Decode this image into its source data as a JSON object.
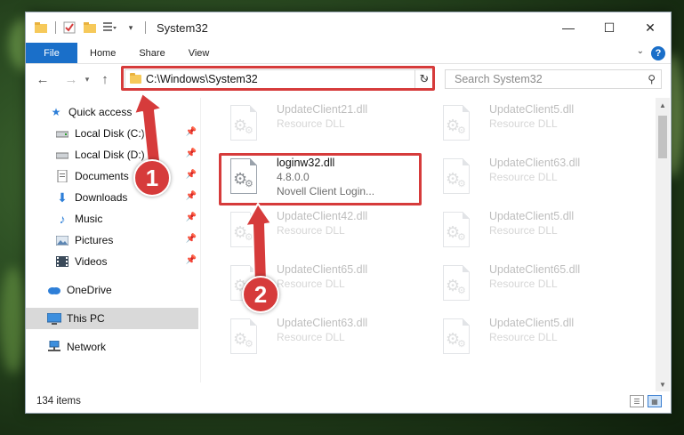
{
  "window": {
    "title": "System32",
    "controls": {
      "minimize": "—",
      "maximize": "☐",
      "close": "✕"
    }
  },
  "ribbon": {
    "tabs": [
      "File",
      "Home",
      "Share",
      "View"
    ],
    "help": "?"
  },
  "navigation": {
    "address": "C:\\Windows\\System32",
    "search_placeholder": "Search System32"
  },
  "sidebar": {
    "items": [
      {
        "label": "Quick access",
        "icon": "star-icon",
        "pinned": false
      },
      {
        "label": "Local Disk (C:)",
        "icon": "drive-icon",
        "pinned": true
      },
      {
        "label": "Local Disk (D:)",
        "icon": "drive-icon",
        "pinned": true
      },
      {
        "label": "Documents",
        "icon": "documents-icon",
        "pinned": true
      },
      {
        "label": "Downloads",
        "icon": "download-icon",
        "pinned": true
      },
      {
        "label": "Music",
        "icon": "music-icon",
        "pinned": true
      },
      {
        "label": "Pictures",
        "icon": "pictures-icon",
        "pinned": true
      },
      {
        "label": "Videos",
        "icon": "videos-icon",
        "pinned": true
      },
      {
        "label": "OneDrive",
        "icon": "cloud-icon",
        "pinned": false
      },
      {
        "label": "This PC",
        "icon": "computer-icon",
        "pinned": false,
        "selected": true
      },
      {
        "label": "Network",
        "icon": "network-icon",
        "pinned": false
      }
    ]
  },
  "files": [
    {
      "name": "UpdateClient21.dll",
      "detail": "Resource DLL",
      "faded": true
    },
    {
      "name": "UpdateClient5.dll",
      "detail": "Resource DLL",
      "faded": true
    },
    {
      "name": "loginw32.dll",
      "version": "4.8.0.0",
      "description": "Novell Client Login...",
      "faded": false
    },
    {
      "name": "UpdateClient63.dll",
      "detail": "Resource DLL",
      "faded": true
    },
    {
      "name": "UpdateClient42.dll",
      "detail": "Resource DLL",
      "faded": true
    },
    {
      "name": "UpdateClient5.dll",
      "detail": "Resource DLL",
      "faded": true
    },
    {
      "name": "UpdateClient65.dll",
      "detail": "Resource DLL",
      "faded": true
    },
    {
      "name": "UpdateClient65.dll",
      "detail": "Resource DLL",
      "faded": true
    },
    {
      "name": "UpdateClient63.dll",
      "detail": "Resource DLL",
      "faded": true
    },
    {
      "name": "UpdateClient5.dll",
      "detail": "Resource DLL",
      "faded": true
    }
  ],
  "status": {
    "item_count": "134 items"
  },
  "annotations": {
    "marker1": "1",
    "marker2": "2",
    "highlight_color": "#d63b3b"
  }
}
